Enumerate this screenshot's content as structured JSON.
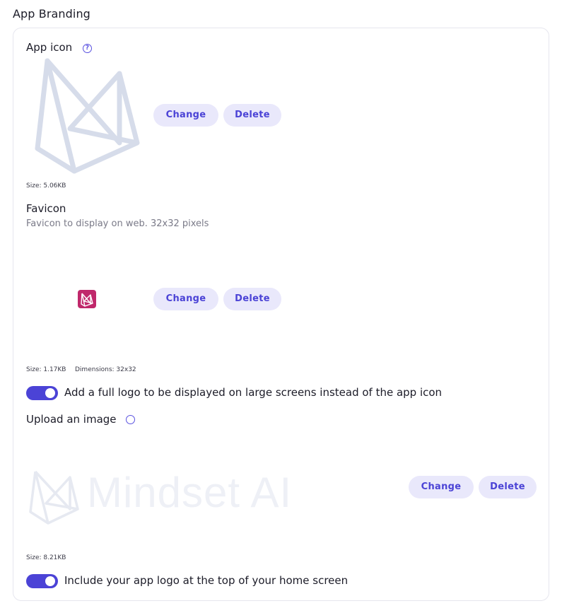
{
  "section": {
    "title": "App Branding"
  },
  "app_icon": {
    "label": "App icon",
    "change_label": "Change",
    "delete_label": "Delete",
    "size_text": "Size: 5.06KB"
  },
  "favicon": {
    "label": "Favicon",
    "description": "Favicon to display on web. 32x32 pixels",
    "change_label": "Change",
    "delete_label": "Delete",
    "size_text": "Size: 1.17KB",
    "dimensions_text": "Dimensions: 32x32"
  },
  "full_logo_toggle": {
    "label": "Add a full logo to be displayed on large screens instead of the app icon",
    "checked": true
  },
  "upload_image": {
    "label": "Upload an image",
    "logo_text": "Mindset AI",
    "change_label": "Change",
    "delete_label": "Delete",
    "size_text": "Size: 8.21KB"
  },
  "home_logo_toggle": {
    "label": "Include your app logo at the top of your home screen",
    "checked": true
  },
  "colors": {
    "accent": "#4b43d6",
    "button_bg": "#e9e8fb",
    "favicon_bg": "#c0286b",
    "icon_placeholder": "#d6dcea"
  },
  "icons": {
    "help": "question-circle-icon",
    "app_logo": "mindset-logo-icon"
  }
}
